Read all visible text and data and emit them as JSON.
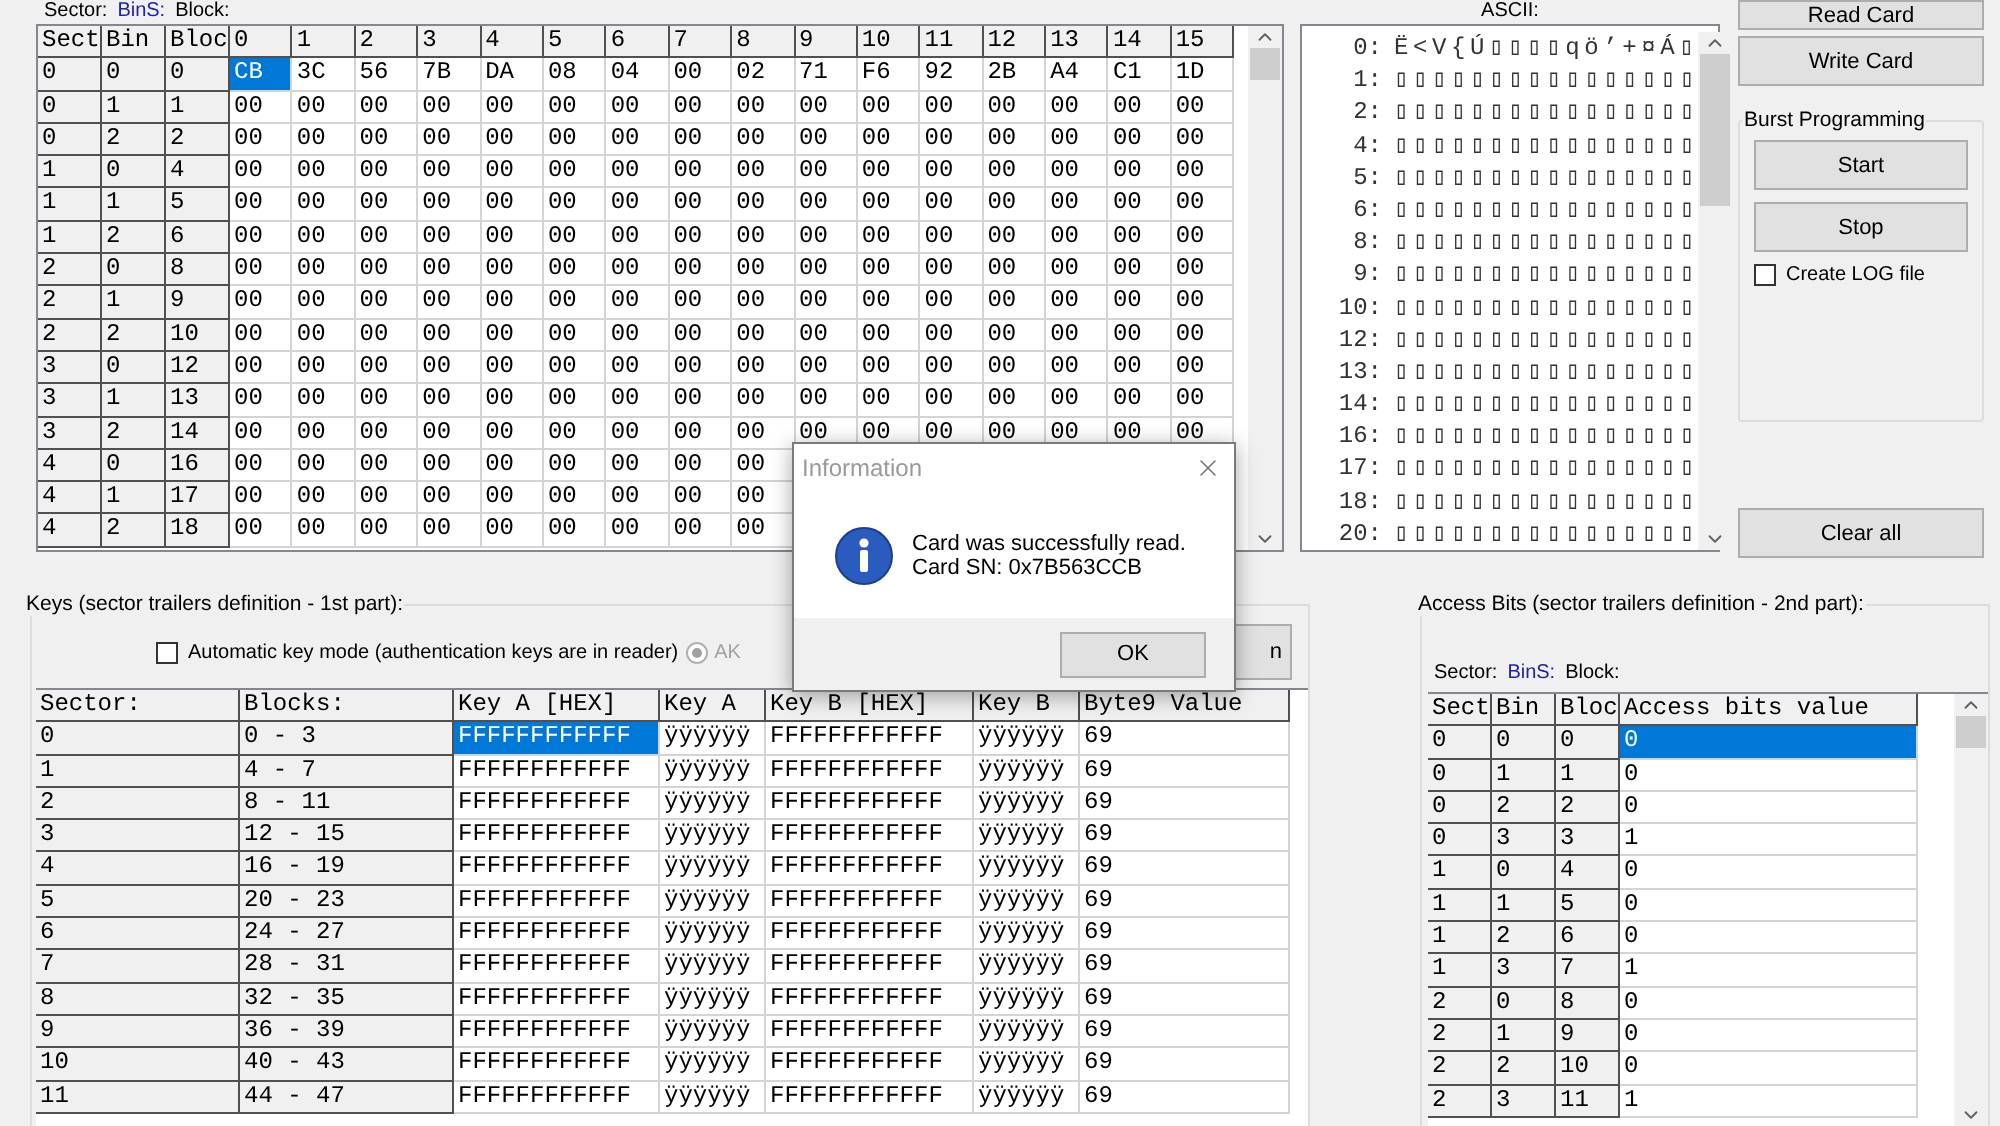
{
  "data_grid": {
    "caption": {
      "sector": "Sector:",
      "bins": "BinS:",
      "block": "Block:"
    },
    "columns": [
      "Sect",
      "Bin",
      "Bloc",
      "0",
      "1",
      "2",
      "3",
      "4",
      "5",
      "6",
      "7",
      "8",
      "9",
      "10",
      "11",
      "12",
      "13",
      "14",
      "15"
    ],
    "rows": [
      {
        "sector": "0",
        "bins": "0",
        "block": "0",
        "selected": true,
        "bytes": [
          "CB",
          "3C",
          "56",
          "7B",
          "DA",
          "08",
          "04",
          "00",
          "02",
          "71",
          "F6",
          "92",
          "2B",
          "A4",
          "C1",
          "1D"
        ]
      },
      {
        "sector": "0",
        "bins": "1",
        "block": "1",
        "selected": false,
        "bytes": [
          "00",
          "00",
          "00",
          "00",
          "00",
          "00",
          "00",
          "00",
          "00",
          "00",
          "00",
          "00",
          "00",
          "00",
          "00",
          "00"
        ]
      },
      {
        "sector": "0",
        "bins": "2",
        "block": "2",
        "selected": false,
        "bytes": [
          "00",
          "00",
          "00",
          "00",
          "00",
          "00",
          "00",
          "00",
          "00",
          "00",
          "00",
          "00",
          "00",
          "00",
          "00",
          "00"
        ]
      },
      {
        "sector": "1",
        "bins": "0",
        "block": "4",
        "selected": false,
        "bytes": [
          "00",
          "00",
          "00",
          "00",
          "00",
          "00",
          "00",
          "00",
          "00",
          "00",
          "00",
          "00",
          "00",
          "00",
          "00",
          "00"
        ]
      },
      {
        "sector": "1",
        "bins": "1",
        "block": "5",
        "selected": false,
        "bytes": [
          "00",
          "00",
          "00",
          "00",
          "00",
          "00",
          "00",
          "00",
          "00",
          "00",
          "00",
          "00",
          "00",
          "00",
          "00",
          "00"
        ]
      },
      {
        "sector": "1",
        "bins": "2",
        "block": "6",
        "selected": false,
        "bytes": [
          "00",
          "00",
          "00",
          "00",
          "00",
          "00",
          "00",
          "00",
          "00",
          "00",
          "00",
          "00",
          "00",
          "00",
          "00",
          "00"
        ]
      },
      {
        "sector": "2",
        "bins": "0",
        "block": "8",
        "selected": false,
        "bytes": [
          "00",
          "00",
          "00",
          "00",
          "00",
          "00",
          "00",
          "00",
          "00",
          "00",
          "00",
          "00",
          "00",
          "00",
          "00",
          "00"
        ]
      },
      {
        "sector": "2",
        "bins": "1",
        "block": "9",
        "selected": false,
        "bytes": [
          "00",
          "00",
          "00",
          "00",
          "00",
          "00",
          "00",
          "00",
          "00",
          "00",
          "00",
          "00",
          "00",
          "00",
          "00",
          "00"
        ]
      },
      {
        "sector": "2",
        "bins": "2",
        "block": "10",
        "selected": false,
        "bytes": [
          "00",
          "00",
          "00",
          "00",
          "00",
          "00",
          "00",
          "00",
          "00",
          "00",
          "00",
          "00",
          "00",
          "00",
          "00",
          "00"
        ]
      },
      {
        "sector": "3",
        "bins": "0",
        "block": "12",
        "selected": false,
        "bytes": [
          "00",
          "00",
          "00",
          "00",
          "00",
          "00",
          "00",
          "00",
          "00",
          "00",
          "00",
          "00",
          "00",
          "00",
          "00",
          "00"
        ]
      },
      {
        "sector": "3",
        "bins": "1",
        "block": "13",
        "selected": false,
        "bytes": [
          "00",
          "00",
          "00",
          "00",
          "00",
          "00",
          "00",
          "00",
          "00",
          "00",
          "00",
          "00",
          "00",
          "00",
          "00",
          "00"
        ]
      },
      {
        "sector": "3",
        "bins": "2",
        "block": "14",
        "selected": false,
        "bytes": [
          "00",
          "00",
          "00",
          "00",
          "00",
          "00",
          "00",
          "00",
          "00",
          "00",
          "00",
          "00",
          "00",
          "00",
          "00",
          "00"
        ]
      },
      {
        "sector": "4",
        "bins": "0",
        "block": "16",
        "selected": false,
        "bytes": [
          "00",
          "00",
          "00",
          "00",
          "00",
          "00",
          "00",
          "00",
          "00"
        ]
      },
      {
        "sector": "4",
        "bins": "1",
        "block": "17",
        "selected": false,
        "bytes": [
          "00",
          "00",
          "00",
          "00",
          "00",
          "00",
          "00",
          "00",
          "00"
        ]
      },
      {
        "sector": "4",
        "bins": "2",
        "block": "18",
        "selected": false,
        "bytes": [
          "00",
          "00",
          "00",
          "00",
          "00",
          "00",
          "00",
          "00",
          "00"
        ]
      }
    ]
  },
  "ascii": {
    "label": "ASCII:",
    "lines": [
      {
        "index": "0:",
        "text": "Ë<V{Ú▯▯▯▯qö’+¤Á▯"
      },
      {
        "index": "1:",
        "text": "▯▯▯▯▯▯▯▯▯▯▯▯▯▯▯▯"
      },
      {
        "index": "2:",
        "text": "▯▯▯▯▯▯▯▯▯▯▯▯▯▯▯▯"
      },
      {
        "index": "4:",
        "text": "▯▯▯▯▯▯▯▯▯▯▯▯▯▯▯▯"
      },
      {
        "index": "5:",
        "text": "▯▯▯▯▯▯▯▯▯▯▯▯▯▯▯▯"
      },
      {
        "index": "6:",
        "text": "▯▯▯▯▯▯▯▯▯▯▯▯▯▯▯▯"
      },
      {
        "index": "8:",
        "text": "▯▯▯▯▯▯▯▯▯▯▯▯▯▯▯▯"
      },
      {
        "index": "9:",
        "text": "▯▯▯▯▯▯▯▯▯▯▯▯▯▯▯▯"
      },
      {
        "index": "10:",
        "text": "▯▯▯▯▯▯▯▯▯▯▯▯▯▯▯▯"
      },
      {
        "index": "12:",
        "text": "▯▯▯▯▯▯▯▯▯▯▯▯▯▯▯▯"
      },
      {
        "index": "13:",
        "text": "▯▯▯▯▯▯▯▯▯▯▯▯▯▯▯▯"
      },
      {
        "index": "14:",
        "text": "▯▯▯▯▯▯▯▯▯▯▯▯▯▯▯▯"
      },
      {
        "index": "16:",
        "text": "▯▯▯▯▯▯▯▯▯▯▯▯▯▯▯▯"
      },
      {
        "index": "17:",
        "text": "▯▯▯▯▯▯▯▯▯▯▯▯▯▯▯▯"
      },
      {
        "index": "18:",
        "text": "▯▯▯▯▯▯▯▯▯▯▯▯▯▯▯▯"
      },
      {
        "index": "20:",
        "text": "▯▯▯▯▯▯▯▯▯▯▯▯▯▯▯▯"
      }
    ]
  },
  "actions": {
    "read_card": "Read Card",
    "write_card": "Write Card",
    "burst": {
      "title": "Burst Programming",
      "start": "Start",
      "stop": "Stop",
      "log": {
        "label": "Create LOG file",
        "checked": false
      }
    },
    "clear_all": "Clear all"
  },
  "keys": {
    "title": "Keys (sector trailers definition - 1st part):",
    "auto_key": {
      "label": "Automatic key mode (authentication keys are in reader)",
      "checked": false
    },
    "ak_radio": {
      "label": "AK",
      "selected": true
    },
    "button_1": {
      "label": "n"
    },
    "columns": [
      "Sector:",
      "Blocks:",
      "Key A [HEX]",
      "Key A",
      "Key B [HEX]",
      "Key B",
      "Byte9 Value"
    ],
    "rows": [
      {
        "sector": "0",
        "blocks": "0 - 3",
        "key_a_hex": "FFFFFFFFFFFF",
        "key_a": "ÿÿÿÿÿÿ",
        "key_b_hex": "FFFFFFFFFFFF",
        "key_b": "ÿÿÿÿÿÿ",
        "byte9": "69",
        "selected": true
      },
      {
        "sector": "1",
        "blocks": "4 - 7",
        "key_a_hex": "FFFFFFFFFFFF",
        "key_a": "ÿÿÿÿÿÿ",
        "key_b_hex": "FFFFFFFFFFFF",
        "key_b": "ÿÿÿÿÿÿ",
        "byte9": "69",
        "selected": false
      },
      {
        "sector": "2",
        "blocks": "8 - 11",
        "key_a_hex": "FFFFFFFFFFFF",
        "key_a": "ÿÿÿÿÿÿ",
        "key_b_hex": "FFFFFFFFFFFF",
        "key_b": "ÿÿÿÿÿÿ",
        "byte9": "69",
        "selected": false
      },
      {
        "sector": "3",
        "blocks": "12 - 15",
        "key_a_hex": "FFFFFFFFFFFF",
        "key_a": "ÿÿÿÿÿÿ",
        "key_b_hex": "FFFFFFFFFFFF",
        "key_b": "ÿÿÿÿÿÿ",
        "byte9": "69",
        "selected": false
      },
      {
        "sector": "4",
        "blocks": "16 - 19",
        "key_a_hex": "FFFFFFFFFFFF",
        "key_a": "ÿÿÿÿÿÿ",
        "key_b_hex": "FFFFFFFFFFFF",
        "key_b": "ÿÿÿÿÿÿ",
        "byte9": "69",
        "selected": false
      },
      {
        "sector": "5",
        "blocks": "20 - 23",
        "key_a_hex": "FFFFFFFFFFFF",
        "key_a": "ÿÿÿÿÿÿ",
        "key_b_hex": "FFFFFFFFFFFF",
        "key_b": "ÿÿÿÿÿÿ",
        "byte9": "69",
        "selected": false
      },
      {
        "sector": "6",
        "blocks": "24 - 27",
        "key_a_hex": "FFFFFFFFFFFF",
        "key_a": "ÿÿÿÿÿÿ",
        "key_b_hex": "FFFFFFFFFFFF",
        "key_b": "ÿÿÿÿÿÿ",
        "byte9": "69",
        "selected": false
      },
      {
        "sector": "7",
        "blocks": "28 - 31",
        "key_a_hex": "FFFFFFFFFFFF",
        "key_a": "ÿÿÿÿÿÿ",
        "key_b_hex": "FFFFFFFFFFFF",
        "key_b": "ÿÿÿÿÿÿ",
        "byte9": "69",
        "selected": false
      },
      {
        "sector": "8",
        "blocks": "32 - 35",
        "key_a_hex": "FFFFFFFFFFFF",
        "key_a": "ÿÿÿÿÿÿ",
        "key_b_hex": "FFFFFFFFFFFF",
        "key_b": "ÿÿÿÿÿÿ",
        "byte9": "69",
        "selected": false
      },
      {
        "sector": "9",
        "blocks": "36 - 39",
        "key_a_hex": "FFFFFFFFFFFF",
        "key_a": "ÿÿÿÿÿÿ",
        "key_b_hex": "FFFFFFFFFFFF",
        "key_b": "ÿÿÿÿÿÿ",
        "byte9": "69",
        "selected": false
      },
      {
        "sector": "10",
        "blocks": "40 - 43",
        "key_a_hex": "FFFFFFFFFFFF",
        "key_a": "ÿÿÿÿÿÿ",
        "key_b_hex": "FFFFFFFFFFFF",
        "key_b": "ÿÿÿÿÿÿ",
        "byte9": "69",
        "selected": false
      },
      {
        "sector": "11",
        "blocks": "44 - 47",
        "key_a_hex": "FFFFFFFFFFFF",
        "key_a": "ÿÿÿÿÿÿ",
        "key_b_hex": "FFFFFFFFFFFF",
        "key_b": "ÿÿÿÿÿÿ",
        "byte9": "69",
        "selected": false
      }
    ]
  },
  "access_bits": {
    "title": "Access Bits (sector trailers definition - 2nd part):",
    "caption": {
      "sector": "Sector:",
      "bins": "BinS:",
      "block": "Block:"
    },
    "columns": [
      "Sect",
      "Bin",
      "Bloc",
      "Access bits value"
    ],
    "rows": [
      {
        "sector": "0",
        "bins": "0",
        "block": "0",
        "value": "0",
        "selected": true
      },
      {
        "sector": "0",
        "bins": "1",
        "block": "1",
        "value": "0",
        "selected": false
      },
      {
        "sector": "0",
        "bins": "2",
        "block": "2",
        "value": "0",
        "selected": false
      },
      {
        "sector": "0",
        "bins": "3",
        "block": "3",
        "value": "1",
        "selected": false
      },
      {
        "sector": "1",
        "bins": "0",
        "block": "4",
        "value": "0",
        "selected": false
      },
      {
        "sector": "1",
        "bins": "1",
        "block": "5",
        "value": "0",
        "selected": false
      },
      {
        "sector": "1",
        "bins": "2",
        "block": "6",
        "value": "0",
        "selected": false
      },
      {
        "sector": "1",
        "bins": "3",
        "block": "7",
        "value": "1",
        "selected": false
      },
      {
        "sector": "2",
        "bins": "0",
        "block": "8",
        "value": "0",
        "selected": false
      },
      {
        "sector": "2",
        "bins": "1",
        "block": "9",
        "value": "0",
        "selected": false
      },
      {
        "sector": "2",
        "bins": "2",
        "block": "10",
        "value": "0",
        "selected": false
      },
      {
        "sector": "2",
        "bins": "3",
        "block": "11",
        "value": "1",
        "selected": false
      }
    ]
  },
  "dialog": {
    "title": "Information",
    "lines": [
      "Card was successfully read.",
      "Card SN: 0x7B563CCB"
    ],
    "ok": "OK"
  }
}
